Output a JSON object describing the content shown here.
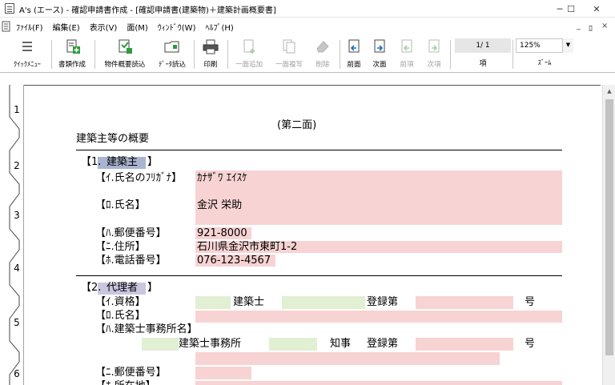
{
  "window": {
    "title": "A's (エース) - 確認申請書作成 - [確認申請書(建築物)＋建築計画概要書]",
    "minimize": "─",
    "maximize": "☐",
    "close": "✕"
  },
  "menu": {
    "items": [
      "ﾌｧｲﾙ(F)",
      "編集(E)",
      "表示(V)",
      "面(M)",
      "ｳｨﾝﾄﾞｳ(W)",
      "ﾍﾙﾌﾟ(H)"
    ],
    "mdi_min": "_",
    "mdi_restore": "ﾛ",
    "mdi_close": "×"
  },
  "toolbar": {
    "quick_menu": "ｸｲｯｸﾒﾆｭｰ",
    "new_doc": "書類作成",
    "import_summary": "物件概要読込",
    "import_data": "ﾃﾞｰﾀ読込",
    "print": "印刷",
    "add_page": "一面追加",
    "copy_page": "一面複写",
    "delete": "削除",
    "prev_page": "前面",
    "next_page": "次面",
    "prev_item": "前項",
    "next_item": "次項",
    "page_value": "1/ 1",
    "page_label": "項",
    "zoom_value": "125%",
    "zoom_label": "ｽﾞｰﾑ",
    "zoom_arrow": "▼"
  },
  "tabs": [
    "1",
    "2",
    "3",
    "4",
    "5",
    "6"
  ],
  "scroll": {
    "up": "▲"
  },
  "form": {
    "page_heading": "(第二面)",
    "doc_title": "建築主等の概要",
    "s1": {
      "open": "【1.",
      "title": "建築主",
      "close": "】",
      "furigana_label": "【ｲ.氏名のﾌﾘｶﾞﾅ】",
      "furigana_value": "ｶﾅｻﾞﾜ ｴｲｽｹ",
      "name_label": "【ﾛ.氏名】",
      "name_value": "金沢 栄助",
      "postal_label": "【ﾊ.郵便番号】",
      "postal_value": "921-8000",
      "address_label": "【ﾆ.住所】",
      "address_value": "石川県金沢市東町1-2",
      "phone_label": "【ﾎ.電話番号】",
      "phone_value": "076-123-4567"
    },
    "s2": {
      "open": "【2.",
      "title": "代理者",
      "close": "】",
      "qual_label": "【ｲ.資格】",
      "qual_arch": "建築士",
      "qual_reg": "登録第",
      "qual_no": "号",
      "name_label": "【ﾛ.氏名】",
      "office_label": "【ﾊ.建築士事務所名】",
      "office_text": "建築士事務所",
      "governor": "知事",
      "office_reg": "登録第",
      "office_no": "号",
      "postal_label": "【ﾆ.郵便番号】",
      "address_label": "【ﾎ.所在地】"
    }
  }
}
